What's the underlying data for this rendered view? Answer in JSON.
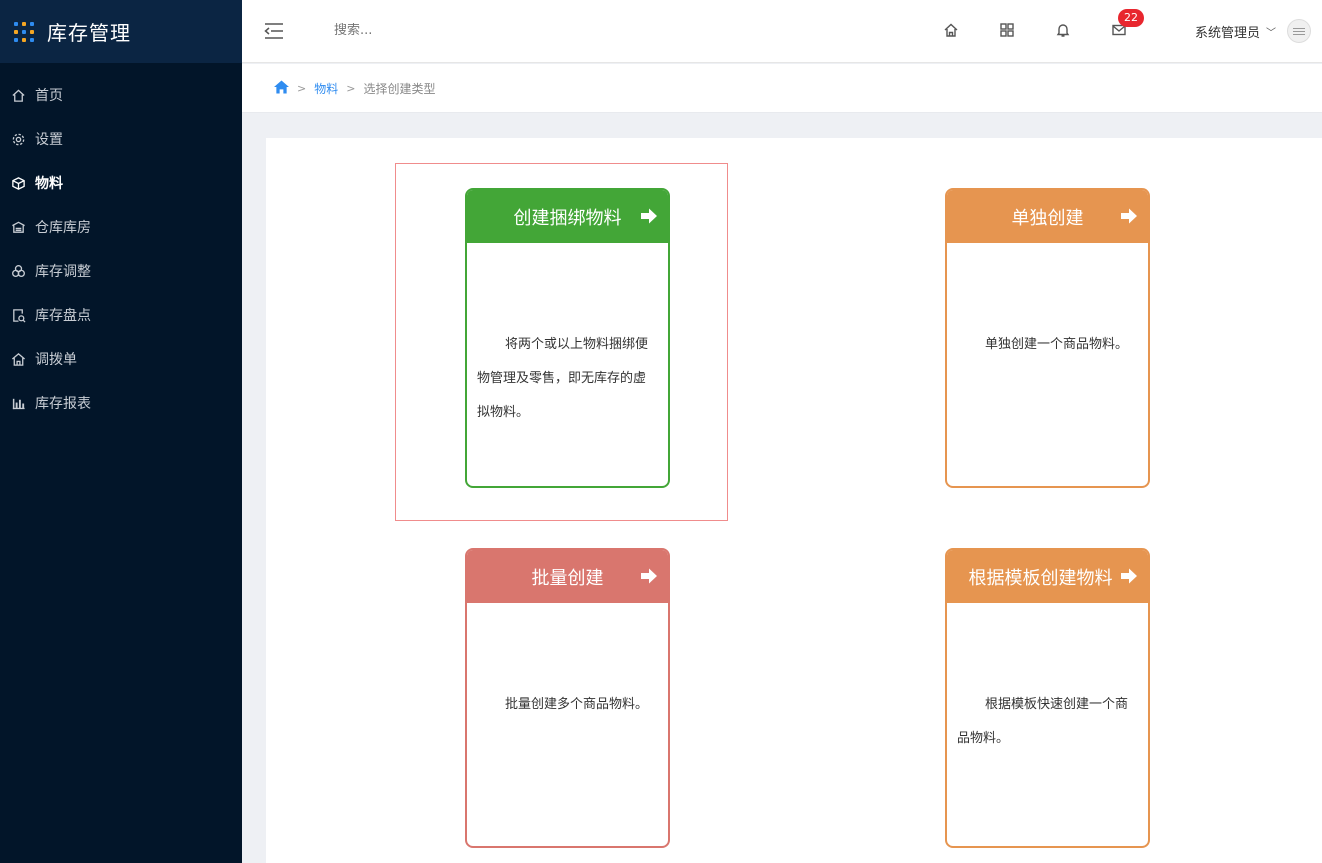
{
  "app": {
    "title": "库存管理"
  },
  "sidebar": {
    "items": [
      {
        "label": "首页",
        "icon": "home-icon"
      },
      {
        "label": "设置",
        "icon": "gear-icon"
      },
      {
        "label": "物料",
        "icon": "cube-icon",
        "active": true
      },
      {
        "label": "仓库库房",
        "icon": "warehouse-icon"
      },
      {
        "label": "库存调整",
        "icon": "adjust-icon"
      },
      {
        "label": "库存盘点",
        "icon": "inventory-check-icon"
      },
      {
        "label": "调拨单",
        "icon": "transfer-icon"
      },
      {
        "label": "库存报表",
        "icon": "bar-chart-icon"
      }
    ]
  },
  "header": {
    "search_placeholder": "搜索...",
    "message_count": "22",
    "user_name": "系统管理员"
  },
  "breadcrumb": {
    "items": [
      "物料",
      "选择创建类型"
    ]
  },
  "cards": [
    {
      "title": "创建捆绑物料",
      "description": "将两个或以上物料捆绑便物管理及零售，即无库存的虚拟物料。",
      "color": "#43a637"
    },
    {
      "title": "单独创建",
      "description": "单独创建一个商品物料。",
      "color": "#e69550"
    },
    {
      "title": "批量创建",
      "description": "批量创建多个商品物料。",
      "color": "#d9766e"
    },
    {
      "title": "根据模板创建物料",
      "description": "根据模板快速创建一个商品物料。",
      "color": "#e69550"
    }
  ],
  "colors": {
    "sidebar_bg": "#021529",
    "accent": "#2f8cf0",
    "badge": "#e8262e"
  }
}
